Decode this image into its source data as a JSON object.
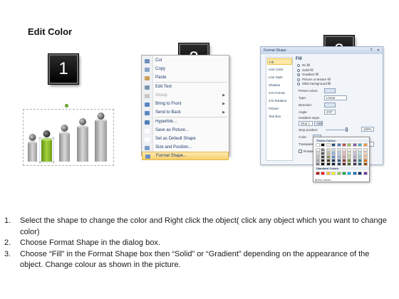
{
  "title": "Edit Color",
  "badges": [
    "1",
    "2",
    "3"
  ],
  "context_menu": {
    "items": [
      {
        "label": "Cut",
        "disabled": false,
        "arrow": false,
        "highlight": false,
        "icon_color": "#6f8fb8"
      },
      {
        "label": "Copy",
        "disabled": false,
        "arrow": false,
        "highlight": false,
        "icon_color": "#8aa6c9"
      },
      {
        "label": "Paste",
        "disabled": false,
        "arrow": false,
        "highlight": false,
        "icon_color": "#c9a15a"
      },
      {
        "label": "Edit Text",
        "disabled": false,
        "arrow": false,
        "highlight": false,
        "icon_color": "#7d95b0"
      },
      {
        "label": "Group",
        "disabled": true,
        "arrow": true,
        "highlight": false,
        "icon_color": "#c8c8c8"
      },
      {
        "label": "Bring to Front",
        "disabled": false,
        "arrow": true,
        "highlight": false,
        "icon_color": "#5c86c4"
      },
      {
        "label": "Send to Back",
        "disabled": false,
        "arrow": true,
        "highlight": false,
        "icon_color": "#5c86c4"
      },
      {
        "label": "Hyperlink...",
        "disabled": false,
        "arrow": false,
        "highlight": false,
        "icon_color": "#4f7fb8"
      },
      {
        "label": "Save as Picture...",
        "disabled": false,
        "arrow": false,
        "highlight": false,
        "icon_color": "#ffffff"
      },
      {
        "label": "Set as Default Shape",
        "disabled": false,
        "arrow": false,
        "highlight": false,
        "icon_color": "#ffffff"
      },
      {
        "label": "Size and Position...",
        "disabled": false,
        "arrow": false,
        "highlight": false,
        "icon_color": "#7a9cc6"
      },
      {
        "label": "Format Shape...",
        "disabled": false,
        "arrow": false,
        "highlight": true,
        "icon_color": "#6d8fbf"
      }
    ]
  },
  "format_dialog": {
    "title": "Format Shape",
    "nav": [
      "Fill",
      "Line Color",
      "Line Style",
      "Shadow",
      "3-D Format",
      "3-D Rotation",
      "Picture",
      "Text Box"
    ],
    "selected_nav": "Fill",
    "section_heading": "Fill",
    "fill_options": [
      {
        "label": "No fill",
        "selected": false
      },
      {
        "label": "Solid fill",
        "selected": false
      },
      {
        "label": "Gradient fill",
        "selected": true
      },
      {
        "label": "Picture or texture fill",
        "selected": false
      },
      {
        "label": "Slide background fill",
        "selected": false
      }
    ],
    "fields": {
      "preset_label": "Preset colors:",
      "type_label": "Type:",
      "type_value": "Linear",
      "direction_label": "Direction:",
      "angle_label": "Angle:",
      "angle_value": "270°",
      "stops_label": "Gradient stops",
      "stop_value": "Stop 1",
      "add_label": "Add",
      "stop_position_label": "Stop position:",
      "stop_position_value": "100%",
      "color_label": "Color:",
      "transparency_label": "Transparency:",
      "transparency_value": "0%",
      "rotate_label": "Rotate with shape"
    }
  },
  "color_palette": {
    "theme_heading": "Theme Colors",
    "standard_heading": "Standard Colors",
    "more_label": "More Colors...",
    "theme_top": [
      "#ffffff",
      "#000000",
      "#eeece1",
      "#1f497d",
      "#4f81bd",
      "#c0504d",
      "#9bbb59",
      "#8064a2",
      "#4bacc6",
      "#f79646"
    ],
    "theme_shades": [
      [
        "#f2f2f2",
        "#7f7f7f",
        "#ddd9c3",
        "#c6d9f0",
        "#dbe5f1",
        "#f2dcdb",
        "#ebf1dd",
        "#e5e0ec",
        "#dbeef3",
        "#fdeada"
      ],
      [
        "#d8d8d8",
        "#595959",
        "#c4bd97",
        "#8db3e2",
        "#b8cce4",
        "#e5b9b7",
        "#d7e3bc",
        "#ccc1d9",
        "#b7dde8",
        "#fbd5b5"
      ],
      [
        "#bfbfbf",
        "#3f3f3f",
        "#938953",
        "#548dd4",
        "#95b3d7",
        "#d99694",
        "#c3d69b",
        "#b2a2c7",
        "#92cddc",
        "#fac08f"
      ],
      [
        "#a5a5a5",
        "#262626",
        "#494429",
        "#17365d",
        "#366092",
        "#953734",
        "#76923c",
        "#5f497a",
        "#31859b",
        "#e36c09"
      ],
      [
        "#7f7f7f",
        "#0c0c0c",
        "#1d1b10",
        "#0f243e",
        "#244061",
        "#632423",
        "#4f6128",
        "#3f3151",
        "#205867",
        "#974806"
      ]
    ],
    "standard": [
      "#c00000",
      "#ff0000",
      "#ffc000",
      "#ffff00",
      "#92d050",
      "#00b050",
      "#00b0f0",
      "#0070c0",
      "#002060",
      "#7030a0"
    ]
  },
  "instructions": [
    {
      "num": "1.",
      "text": "Select the shape to change the color and Right click the object( click any object which you want to change color)"
    },
    {
      "num": "2.",
      "text": "Choose Format Shape in the dialog box."
    },
    {
      "num": "3.",
      "text": "Choose “Fill” in the Format Shape box then “Solid” or “Gradient” depending on the appearance of the object. Change colour as shown in the picture."
    }
  ],
  "colors": {
    "bar_gray": "#a8a8a8",
    "bar_selected_green": "#7cae1e",
    "badge_bg": "#111111",
    "menu_highlight": "#f8cf6c"
  }
}
